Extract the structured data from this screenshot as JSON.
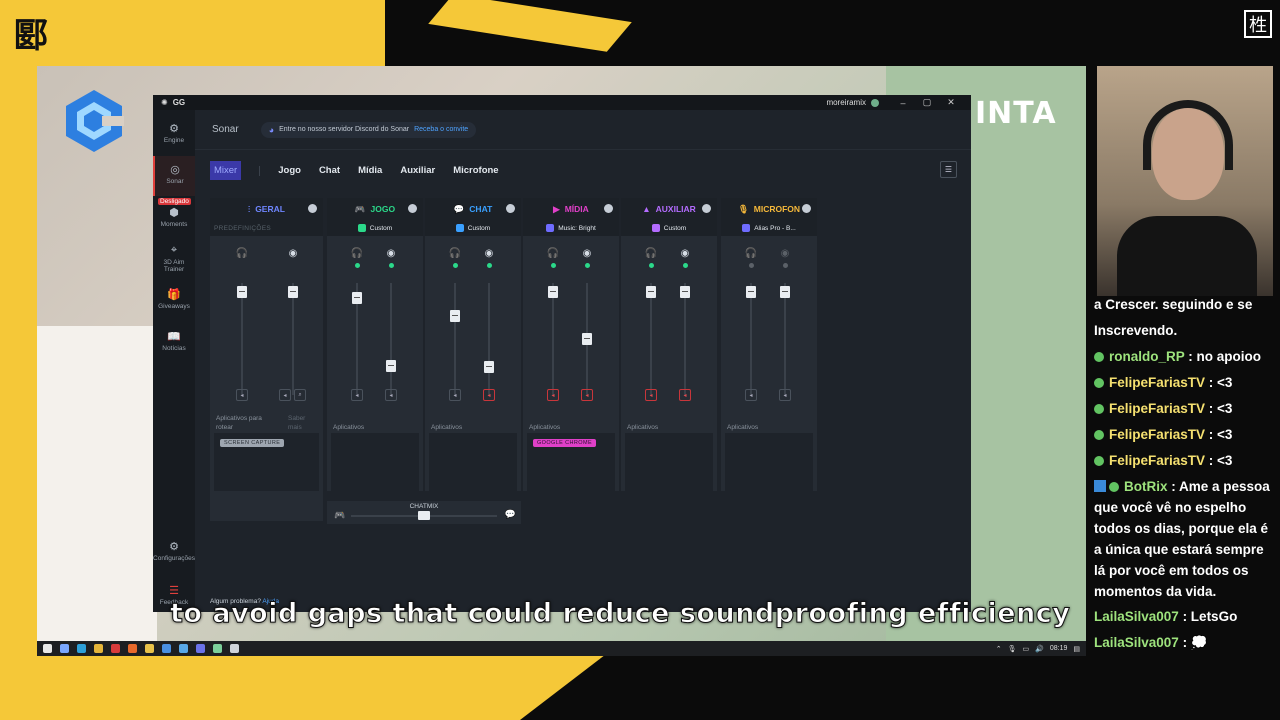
{
  "overlay": {
    "top_left_logo": "郾",
    "top_right_logo": "栍",
    "game_text": "INTA",
    "subtitle": "to avoid gaps that could reduce soundproofing efficiency"
  },
  "taskbar": {
    "time": "08:19"
  },
  "chat": {
    "messages": [
      {
        "user": "",
        "text": "a Crescer. seguindo e se Inscrevendo."
      },
      {
        "user": "ronaldo_RP",
        "text": " : no apoioo"
      },
      {
        "user": "FelipeFariasTV",
        "text": " : <3"
      },
      {
        "user": "FelipeFariasTV",
        "text": " : <3"
      },
      {
        "user": "FelipeFariasTV",
        "text": " : <3"
      },
      {
        "user": "FelipeFariasTV",
        "text": " : <3"
      },
      {
        "user": "BotRix",
        "text": " : Ame a pessoa que você vê no espelho todos os dias, porque ela é a única que estará sempre lá por você em todos os momentos da vida."
      },
      {
        "user": "LailaSilva007",
        "text": " : LetsGo"
      },
      {
        "user": "LailaSilva007",
        "text": " : 💭"
      }
    ]
  },
  "app": {
    "title": "GG",
    "username": "moreiramix",
    "window_controls": {
      "minimize": "–",
      "maximize": "▢",
      "close": "✕"
    },
    "nav": {
      "engine": "Engine",
      "sonar": "Sonar",
      "disconnected": "Desligado",
      "moments": "Moments",
      "aim_trainer": "3D Aim Trainer",
      "giveaways": "Giveaways",
      "news": "Notícias",
      "settings": "Configurações",
      "feedback": "Feedback"
    },
    "header": {
      "title": "Sonar",
      "discord_text": "Entre no nosso servidor Discord do Sonar",
      "discord_link": "Receba o convite"
    },
    "tabs": {
      "mixer": "Mixer",
      "game": "Jogo",
      "chat": "Chat",
      "media": "Mídia",
      "aux": "Auxiliar",
      "mic": "Microfone"
    },
    "channels": {
      "geral": {
        "name": "GERAL",
        "preset": "PREDEFINIÇÕES",
        "apps_label": "Aplicativos para rotear",
        "learn_more": "Saber mais",
        "app": "SCREEN CAPTURE",
        "color": "#6f86ff"
      },
      "jogo": {
        "name": "JOGO",
        "preset": "Custom",
        "apps_label": "Aplicativos",
        "color": "#2bd98a"
      },
      "chat": {
        "name": "CHAT",
        "preset": "Custom",
        "apps_label": "Aplicativos",
        "color": "#3aa0ff"
      },
      "midia": {
        "name": "MÍDIA",
        "preset": "Music: Bright",
        "apps_label": "Aplicativos",
        "app": "GOOGLE CHROME",
        "color": "#e040c8"
      },
      "auxiliar": {
        "name": "AUXILIAR",
        "preset": "Custom",
        "apps_label": "Aplicativos",
        "color": "#b46cff"
      },
      "microfone": {
        "name": "MICROFON",
        "preset": "Alias Pro - B...",
        "apps_label": "Aplicativos",
        "color": "#f5b83a"
      }
    },
    "chatmix_label": "CHATMIX",
    "footer": {
      "text": "Algum problema?",
      "link": "Ajuda"
    }
  }
}
